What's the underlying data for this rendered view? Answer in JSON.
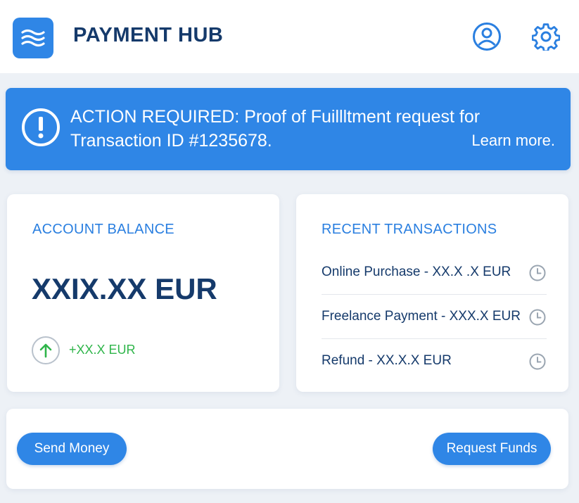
{
  "header": {
    "title": "PAYMENT HUB",
    "icons": {
      "logo": "waves-logo-icon",
      "profile": "user-circle-icon",
      "settings": "gear-icon"
    }
  },
  "alert": {
    "icon": "exclamation-circle-icon",
    "message": "ACTION REQUIRED: Proof of Fuillltment request for Transaction ID #1235678.",
    "link": "Learn more."
  },
  "balance": {
    "heading": "ACCOUNT BALANCE",
    "amount": "XXIX.XX EUR",
    "change": "+XX.X EUR",
    "change_icon": "arrow-up-icon"
  },
  "transactions": {
    "heading": "RECENT TRANSACTIONS",
    "items": [
      {
        "label": "Online Purchase - XX.X .X EUR",
        "icon": "clock-icon"
      },
      {
        "label": "Freelance Payment - XXX.X EUR",
        "icon": "clock-icon"
      },
      {
        "label": "Refund - XX.X.X EUR",
        "icon": "clock-icon"
      }
    ]
  },
  "actions": {
    "send": "Send Money",
    "request": "Request Funds"
  },
  "colors": {
    "primary": "#2f86e6",
    "navy": "#153a6b",
    "positive": "#2fb54a",
    "background": "#edf1f6"
  }
}
